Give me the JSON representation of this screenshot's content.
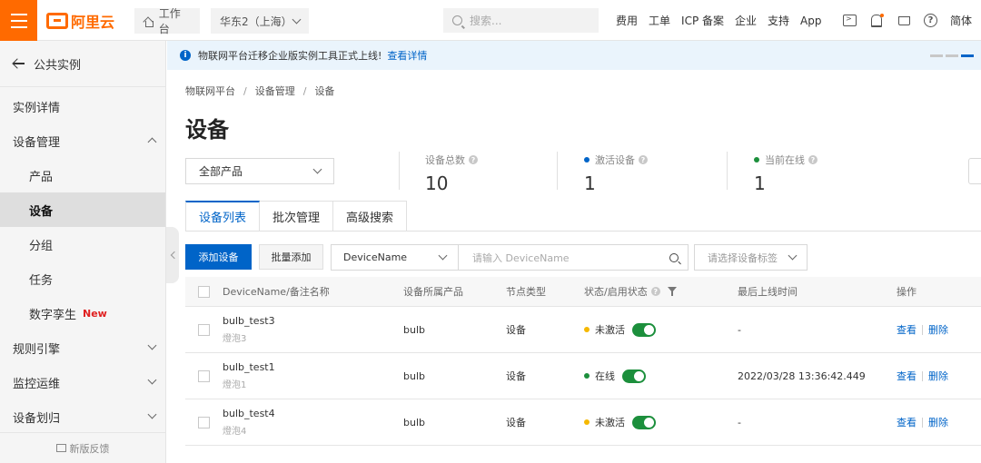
{
  "topbar": {
    "logo": "阿里云",
    "workbench": "工作台",
    "region": "华东2（上海）",
    "search_placeholder": "搜索...",
    "links": [
      "费用",
      "工单",
      "ICP 备案",
      "企业",
      "支持",
      "App"
    ],
    "language": "简体"
  },
  "sidebar": {
    "back": "公共实例",
    "items": [
      {
        "label": "实例详情"
      },
      {
        "label": "设备管理"
      },
      {
        "label": "产品"
      },
      {
        "label": "设备"
      },
      {
        "label": "分组"
      },
      {
        "label": "任务"
      },
      {
        "label": "数字孪生",
        "badge": "New"
      },
      {
        "label": "规则引擎"
      },
      {
        "label": "监控运维"
      },
      {
        "label": "设备划归"
      }
    ],
    "feedback": "新版反馈"
  },
  "notice": {
    "text": "物联网平台迁移企业版实例工具正式上线!",
    "link": "查看详情"
  },
  "breadcrumb": [
    "物联网平台",
    "设备管理",
    "设备"
  ],
  "page_title": "设备",
  "product_filter": "全部产品",
  "stats": [
    {
      "label": "设备总数",
      "value": "10"
    },
    {
      "label": "激活设备",
      "value": "1",
      "dot_color": "#0064c8"
    },
    {
      "label": "当前在线",
      "value": "1",
      "dot_color": "#1c8f3c"
    }
  ],
  "tabs": [
    "设备列表",
    "批次管理",
    "高级搜索"
  ],
  "toolbar": {
    "add_device": "添加设备",
    "batch_add": "批量添加",
    "field": "DeviceName",
    "search_placeholder": "请输入 DeviceName",
    "tag_placeholder": "请选择设备标签"
  },
  "table": {
    "columns": [
      "DeviceName/备注名称",
      "设备所属产品",
      "节点类型",
      "状态/启用状态",
      "最后上线时间",
      "操作"
    ],
    "rows": [
      {
        "name": "bulb_test3",
        "note": "燈泡3",
        "product": "bulb",
        "node": "设备",
        "status": "未激活",
        "status_color": "#f5b800",
        "last_online": "-",
        "view": "查看",
        "delete": "删除"
      },
      {
        "name": "bulb_test1",
        "note": "燈泡1",
        "product": "bulb",
        "node": "设备",
        "status": "在线",
        "status_color": "#1c8f3c",
        "last_online": "2022/03/28 13:36:42.449",
        "view": "查看",
        "delete": "删除"
      },
      {
        "name": "bulb_test4",
        "note": "燈泡4",
        "product": "bulb",
        "node": "设备",
        "status": "未激活",
        "status_color": "#f5b800",
        "last_online": "-",
        "view": "查看",
        "delete": "删除"
      }
    ]
  },
  "colors": {
    "brand": "#ff6a00",
    "primary": "#0064c8",
    "online": "#1c8f3c",
    "inactive": "#f5b800"
  }
}
